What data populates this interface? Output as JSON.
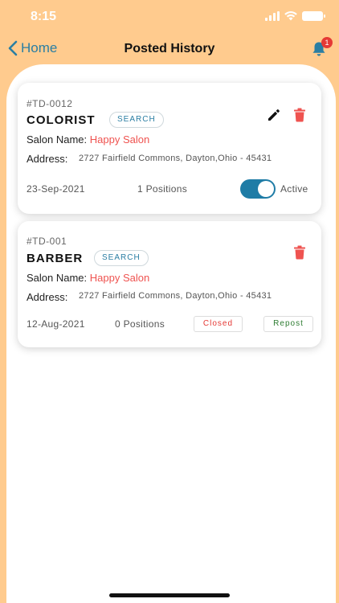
{
  "status_bar": {
    "time": "8:15"
  },
  "nav": {
    "back_label": "Home",
    "title": "Posted History",
    "notification_count": "1"
  },
  "colors": {
    "background": "#ffcb8e",
    "accent": "#2a7ea3",
    "salon_name": "#ef5350",
    "toggle_on": "#1f7ca6"
  },
  "jobs": [
    {
      "id": "#TD-0012",
      "title": "COLORIST",
      "tag": "SEARCH",
      "salon_label": "Salon Name:",
      "salon_name": "Happy Salon",
      "address_label": "Address:",
      "address": "2727 Fairfield Commons, Dayton,Ohio - 45431",
      "date": "23-Sep-2021",
      "positions": "1 Positions",
      "status_label": "Active",
      "active": true,
      "icons": [
        "edit-icon",
        "trash-icon"
      ]
    },
    {
      "id": "#TD-001",
      "title": "BARBER",
      "tag": "SEARCH",
      "salon_label": "Salon Name:",
      "salon_name": "Happy Salon",
      "address_label": "Address:",
      "address": "2727 Fairfield Commons, Dayton,Ohio - 45431",
      "date": "12-Aug-2021",
      "positions": "0 Positions",
      "closed_label": "Closed",
      "repost_label": "Repost",
      "icons": [
        "trash-icon"
      ]
    }
  ]
}
